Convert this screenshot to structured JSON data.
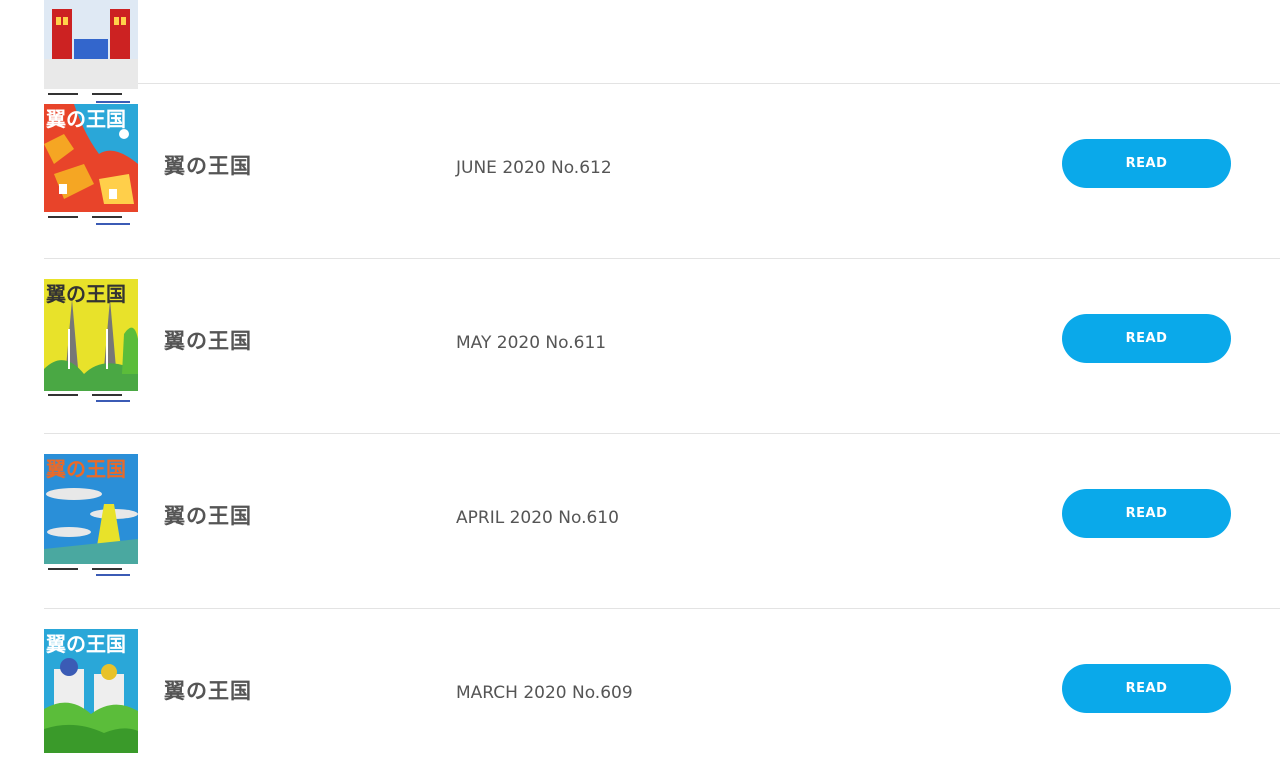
{
  "issues": [
    {
      "title": "",
      "issue": "",
      "read_label": "",
      "palette": [
        "#cc2222",
        "#f2f2f2",
        "#3366cc"
      ]
    },
    {
      "title": "翼の王国",
      "issue": "JUNE 2020 No.612",
      "read_label": "READ",
      "palette": [
        "#e8442a",
        "#2aa7d8",
        "#f5a623"
      ]
    },
    {
      "title": "翼の王国",
      "issue": "MAY 2020 No.611",
      "read_label": "READ",
      "palette": [
        "#e8e22a",
        "#777777",
        "#4aa844"
      ]
    },
    {
      "title": "翼の王国",
      "issue": "APRIL 2020 No.610",
      "read_label": "READ",
      "palette": [
        "#2a8fd8",
        "#e8e8e8",
        "#e86a2a"
      ]
    },
    {
      "title": "翼の王国",
      "issue": "MARCH 2020 No.609",
      "read_label": "READ",
      "palette": [
        "#2aa7d8",
        "#eeeeee",
        "#5bbd3a"
      ]
    }
  ],
  "cover_logo": "翼の王国",
  "colors": {
    "accent": "#0aa9ea",
    "divider": "#e3e3e3",
    "text": "#555555"
  }
}
